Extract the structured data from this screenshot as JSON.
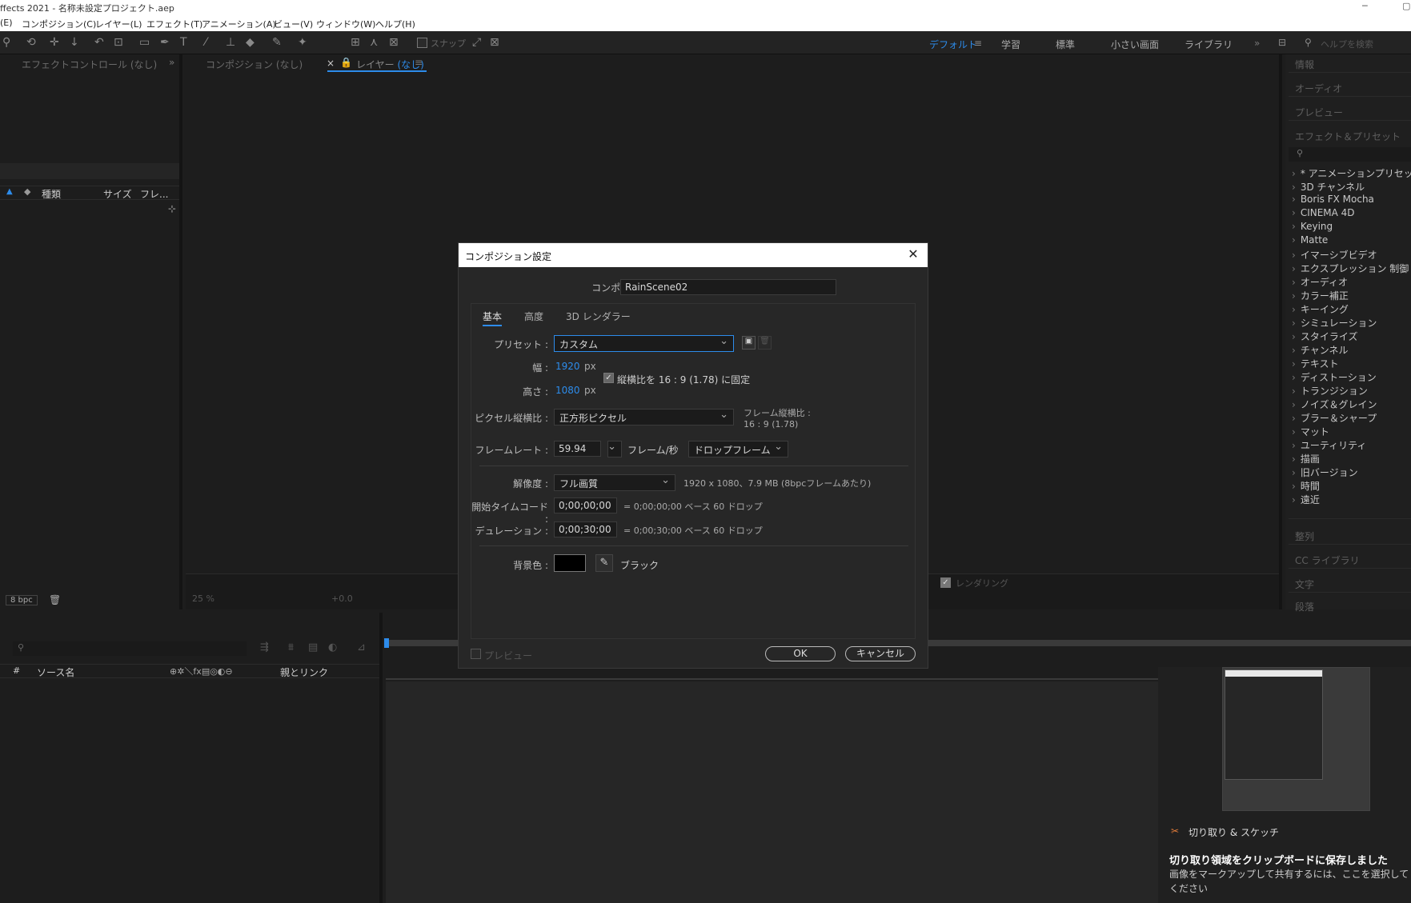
{
  "window": {
    "title": "ffects 2021 - 名称未設定プロジェクト.aep",
    "minimize_glyph": "─",
    "restore_glyph": "▢"
  },
  "menu": [
    "(E)",
    "コンポジション(C)",
    "レイヤー(L)",
    "エフェクト(T)",
    "アニメーション(A)",
    "ビュー(V)",
    "ウィンドウ(W)",
    "ヘルプ(H)"
  ],
  "toolbar": {
    "snap_label": "スナップ",
    "workspaces": [
      "デフォルト",
      "学習",
      "標準",
      "小さい画面",
      "ライブラリ"
    ],
    "more_glyph": "»",
    "search_placeholder": "ヘルプを検索"
  },
  "left_panel": {
    "tab_label": "エフェクトコントロール (なし)",
    "columns": [
      "種類",
      "サイズ",
      "フレ..."
    ],
    "bpc_label": "8 bpc"
  },
  "viewer": {
    "tab_comp": "コンポジション (なし)",
    "tab_layer_prefix": "レイヤー",
    "tab_layer_value": "(なし)",
    "zoom": "25 %",
    "exposure": "+0.0",
    "render_label": "レンダリング"
  },
  "right_panel": {
    "headers_top": [
      "情報",
      "オーディオ",
      "プレビュー",
      "エフェクト＆プリセット"
    ],
    "effects": [
      "* アニメーションプリセット",
      "3D チャンネル",
      "Boris FX Mocha",
      "CINEMA 4D",
      "Keying",
      "Matte",
      "イマーシブビデオ",
      "エクスプレッション 制御",
      "オーディオ",
      "カラー補正",
      "キーイング",
      "シミュレーション",
      "スタイライズ",
      "チャンネル",
      "テキスト",
      "ディストーション",
      "トランジション",
      "ノイズ＆グレイン",
      "ブラー＆シャープ",
      "マット",
      "ユーティリティ",
      "描画",
      "旧バージョン",
      "時間",
      "遠近"
    ],
    "headers_bottom": [
      "整列",
      "CC ライブラリ",
      "文字",
      "段落"
    ]
  },
  "timeline": {
    "col_hash": "#",
    "col_source": "ソース名",
    "col_parent": "親とリンク"
  },
  "dialog": {
    "title": "コンポジション設定",
    "close_glyph": "✕",
    "comp_name_label": "コンポジション名 :",
    "comp_name_value": "RainScene02",
    "tabs": [
      "基本",
      "高度",
      "3D レンダラー"
    ],
    "preset_label": "プリセット :",
    "preset_value": "カスタム",
    "width_label": "幅 :",
    "width_value": "1920",
    "height_label": "高さ :",
    "height_value": "1080",
    "unit_px": "px",
    "lock_aspect_label": "縦横比を 16 : 9 (1.78) に固定",
    "pixel_aspect_label": "ピクセル縦横比 :",
    "pixel_aspect_value": "正方形ピクセル",
    "frame_aspect_label": "フレーム縦横比 :",
    "frame_aspect_value": "16 : 9 (1.78)",
    "framerate_label": "フレームレート :",
    "framerate_value": "59.94",
    "framerate_unit": "フレーム/秒",
    "drop_frame_value": "ドロップフレーム",
    "resolution_label": "解像度 :",
    "resolution_value": "フル画質",
    "resolution_info": "1920 x 1080、7.9 MB (8bpcフレームあたり)",
    "start_tc_label": "開始タイムコード :",
    "start_tc_value": "0;00;00;00",
    "start_tc_info": "= 0;00;00;00  ベース 60  ドロップ",
    "duration_label": "デュレーション :",
    "duration_value": "0;00;30;00",
    "duration_info": "= 0;00;30;00  ベース 60  ドロップ",
    "bg_label": "背景色 :",
    "bg_color": "#000000",
    "bg_color_name": "ブラック",
    "preview_label": "プレビュー",
    "ok_label": "OK",
    "cancel_label": "キャンセル"
  },
  "snip": {
    "app_name": "切り取り & スケッチ",
    "headline": "切り取り領域をクリップボードに保存しました",
    "body": "画像をマークアップして共有するには、ここを選択してください"
  },
  "colors": {
    "accent": "#2d8ceb",
    "panel_bg": "#1d1d1d",
    "dialog_bg": "#272727"
  }
}
